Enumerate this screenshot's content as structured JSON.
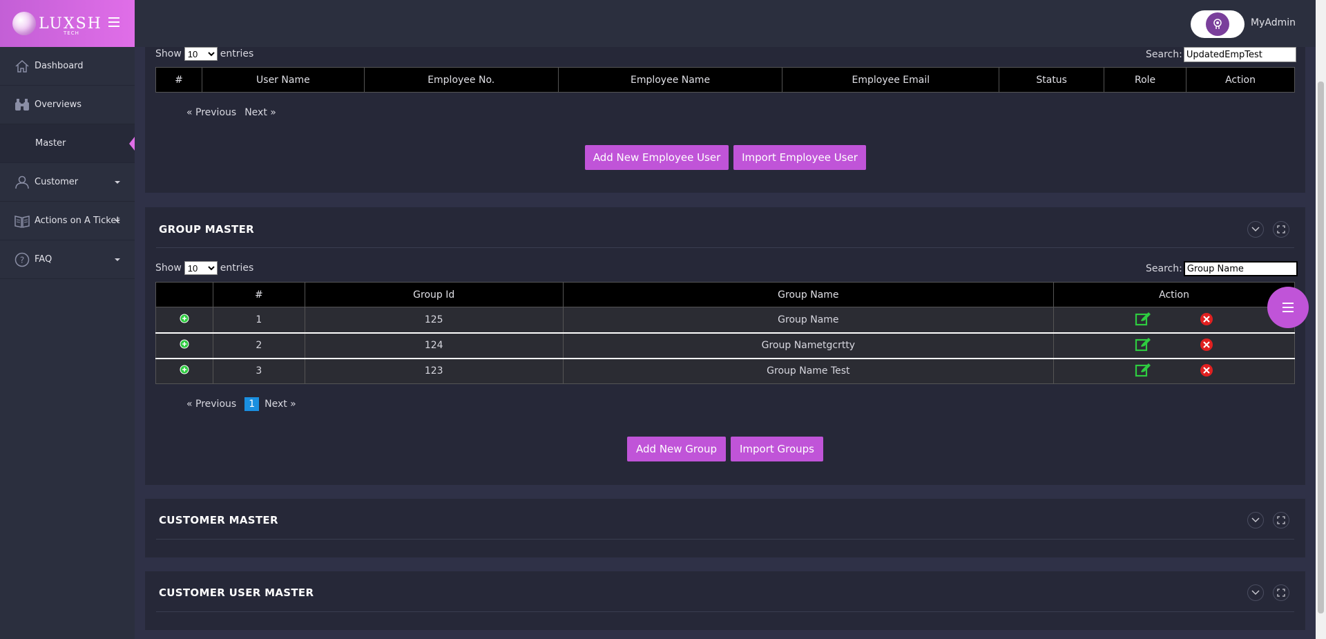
{
  "brand": {
    "name": "LUXSH",
    "sub": "TECH"
  },
  "topbar": {
    "user_name": "MyAdmin"
  },
  "sidebar": {
    "items": [
      {
        "label": "Dashboard",
        "icon": "home-icon",
        "caret": false
      },
      {
        "label": "Overviews",
        "icon": "binoculars-icon",
        "caret": false
      },
      {
        "label": "Master",
        "icon": "",
        "caret": false,
        "active": true
      },
      {
        "label": "Customer",
        "icon": "user-icon",
        "caret": true
      },
      {
        "label": "Actions on A Ticket",
        "icon": "book-icon",
        "caret": true
      },
      {
        "label": "FAQ",
        "icon": "help-icon",
        "caret": true
      }
    ]
  },
  "employee_panel": {
    "show_label": "Show",
    "entries_label": "entries",
    "page_size": "10",
    "search_label": "Search:",
    "search_value": "UpdatedEmpTest",
    "columns": [
      "#",
      "User Name",
      "Employee No.",
      "Employee Name",
      "Employee Email",
      "Status",
      "Role",
      "Action"
    ],
    "pager": {
      "prev": "« Previous",
      "next": "Next »"
    },
    "buttons": {
      "add": "Add New Employee User",
      "import": "Import Employee User"
    }
  },
  "group_panel": {
    "title": "GROUP MASTER",
    "show_label": "Show",
    "entries_label": "entries",
    "page_size": "10",
    "search_label": "Search:",
    "search_value": "Group Name",
    "columns": [
      "",
      "#",
      "Group Id",
      "Group Name",
      "Action"
    ],
    "rows": [
      {
        "num": "1",
        "group_id": "125",
        "group_name": "Group Name"
      },
      {
        "num": "2",
        "group_id": "124",
        "group_name": "Group Nametgcrtty"
      },
      {
        "num": "3",
        "group_id": "123",
        "group_name": "Group Name Test"
      }
    ],
    "pager": {
      "prev": "« Previous",
      "page": "1",
      "next": "Next »"
    },
    "buttons": {
      "add": "Add New Group",
      "import": "Import Groups"
    }
  },
  "customer_panel": {
    "title": "CUSTOMER MASTER"
  },
  "customer_user_panel": {
    "title": "CUSTOMER USER MASTER"
  },
  "colors": {
    "accent": "#c054d8",
    "page_active": "#1a8fe0",
    "edit": "#2ecc40",
    "delete": "#e02020"
  }
}
